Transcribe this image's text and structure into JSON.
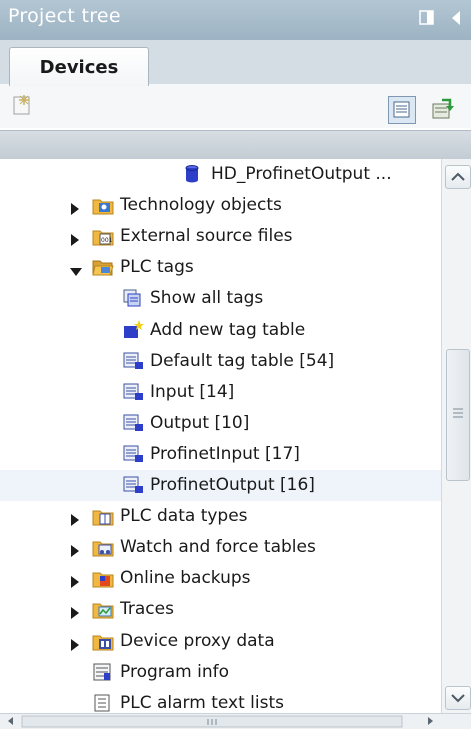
{
  "panel": {
    "title": "Project tree"
  },
  "tabs": [
    {
      "label": "Devices"
    }
  ],
  "tree": {
    "items": [
      {
        "label": "HD_ProfinetOutput ...",
        "icon": "db-cylinder-icon",
        "arrow": "none",
        "level": 3
      },
      {
        "label": "Technology objects",
        "icon": "technology-objects-icon",
        "arrow": "collapsed",
        "level": 2
      },
      {
        "label": "External source files",
        "icon": "external-source-files-icon",
        "arrow": "collapsed",
        "level": 2
      },
      {
        "label": "PLC tags",
        "icon": "folder-open-icon",
        "arrow": "expanded",
        "level": 2
      },
      {
        "label": "Show all tags",
        "icon": "show-all-tags-icon",
        "arrow": "none",
        "level": 3
      },
      {
        "label": "Add new tag table",
        "icon": "add-new-tag-table-icon",
        "arrow": "none",
        "level": 3
      },
      {
        "label": "Default tag table [54]",
        "icon": "tag-table-icon",
        "arrow": "none",
        "level": 3
      },
      {
        "label": "Input [14]",
        "icon": "tag-table-icon",
        "arrow": "none",
        "level": 3
      },
      {
        "label": "Output [10]",
        "icon": "tag-table-icon",
        "arrow": "none",
        "level": 3
      },
      {
        "label": "ProfinetInput [17]",
        "icon": "tag-table-icon",
        "arrow": "none",
        "level": 3
      },
      {
        "label": "ProfinetOutput [16]",
        "icon": "tag-table-icon",
        "arrow": "none",
        "level": 3
      },
      {
        "label": "PLC data types",
        "icon": "plc-data-types-icon",
        "arrow": "collapsed",
        "level": 2
      },
      {
        "label": "Watch and force tables",
        "icon": "watch-force-tables-icon",
        "arrow": "collapsed",
        "level": 2
      },
      {
        "label": "Online backups",
        "icon": "online-backups-icon",
        "arrow": "collapsed",
        "level": 2
      },
      {
        "label": "Traces",
        "icon": "traces-icon",
        "arrow": "collapsed",
        "level": 2
      },
      {
        "label": "Device proxy data",
        "icon": "device-proxy-data-icon",
        "arrow": "collapsed",
        "level": 2
      },
      {
        "label": "Program info",
        "icon": "program-info-icon",
        "arrow": "none",
        "level": 2
      },
      {
        "label": "PLC alarm text lists",
        "icon": "alarm-text-lists-icon",
        "arrow": "none",
        "level": 2
      }
    ],
    "selected_index": 10
  },
  "colors": {
    "title_bar": "#a7bbc9",
    "tab_strip": "#d5dde4",
    "arrow": "#1a1a1a",
    "db_icon": "#2d3fc8",
    "folder": "#f0b840"
  }
}
